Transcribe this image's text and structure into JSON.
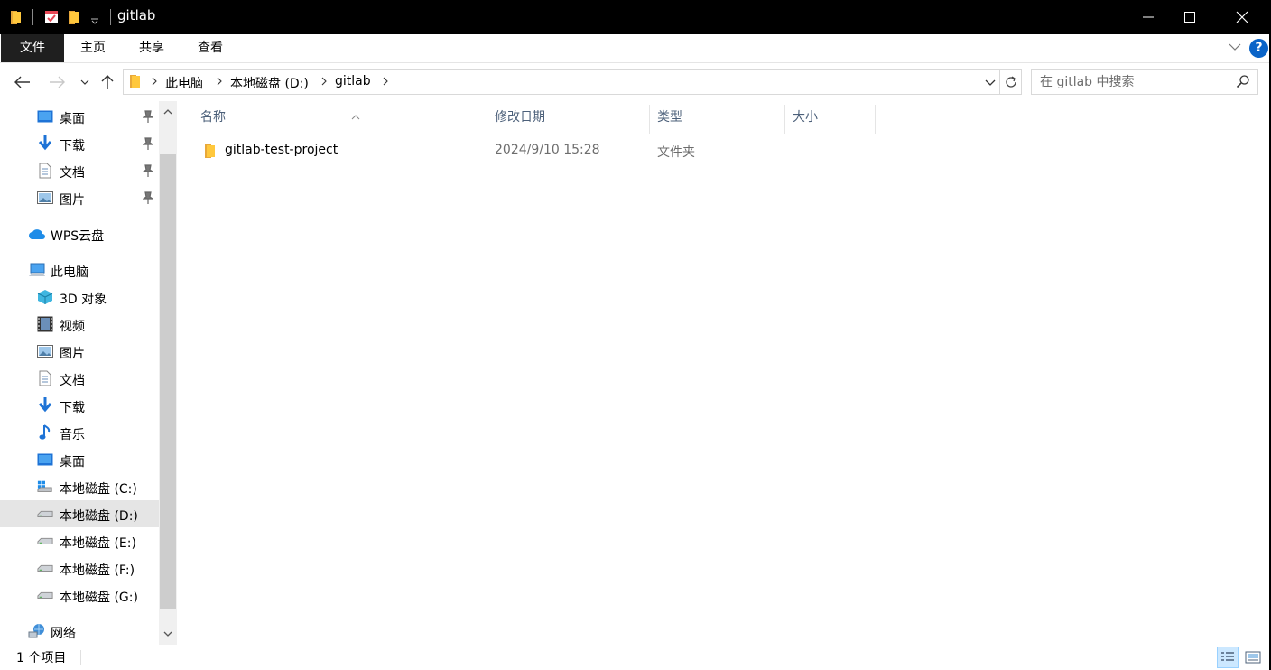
{
  "window": {
    "title": "gitlab",
    "controls": {
      "minimize": "─",
      "maximize": "☐",
      "close": "✕"
    }
  },
  "ribbon": {
    "tabs": [
      "文件",
      "主页",
      "共享",
      "查看"
    ],
    "help": "?"
  },
  "address_bar": {
    "breadcrumbs": [
      "此电脑",
      "本地磁盘 (D:)",
      "gitlab"
    ]
  },
  "search": {
    "placeholder": "在 gitlab 中搜索"
  },
  "sidebar": {
    "quick_access": [
      {
        "label": "桌面",
        "icon": "desktop-icon",
        "pinned": true
      },
      {
        "label": "下载",
        "icon": "download-icon",
        "pinned": true
      },
      {
        "label": "文档",
        "icon": "document-icon",
        "pinned": true
      },
      {
        "label": "图片",
        "icon": "picture-icon",
        "pinned": true
      }
    ],
    "wps_cloud": {
      "label": "WPS云盘",
      "icon": "cloud-icon"
    },
    "this_pc": {
      "label": "此电脑",
      "icon": "computer-icon"
    },
    "pc_items": [
      {
        "label": "3D 对象",
        "icon": "3d-objects-icon"
      },
      {
        "label": "视频",
        "icon": "video-icon"
      },
      {
        "label": "图片",
        "icon": "picture-icon"
      },
      {
        "label": "文档",
        "icon": "document-icon"
      },
      {
        "label": "下载",
        "icon": "download-icon"
      },
      {
        "label": "音乐",
        "icon": "music-icon"
      },
      {
        "label": "桌面",
        "icon": "desktop-icon"
      },
      {
        "label": "本地磁盘 (C:)",
        "icon": "system-drive-icon"
      },
      {
        "label": "本地磁盘 (D:)",
        "icon": "drive-icon",
        "selected": true
      },
      {
        "label": "本地磁盘 (E:)",
        "icon": "drive-icon"
      },
      {
        "label": "本地磁盘 (F:)",
        "icon": "drive-icon"
      },
      {
        "label": "本地磁盘 (G:)",
        "icon": "drive-icon"
      }
    ],
    "network": {
      "label": "网络",
      "icon": "network-icon"
    }
  },
  "file_list": {
    "columns": [
      "名称",
      "修改日期",
      "类型",
      "大小"
    ],
    "rows": [
      {
        "name": "gitlab-test-project",
        "modified": "2024/9/10 15:28",
        "type": "文件夹",
        "size": ""
      }
    ]
  },
  "status_bar": {
    "item_count": "1 个项目"
  },
  "colors": {
    "title_bar": "#000000",
    "file_tab": "#1f1f1f",
    "selected_nav": "#e5e5e5",
    "column_header_text": "#4c607a",
    "folder_yellow": "#ffc83d",
    "help_blue": "#0a64c8"
  }
}
